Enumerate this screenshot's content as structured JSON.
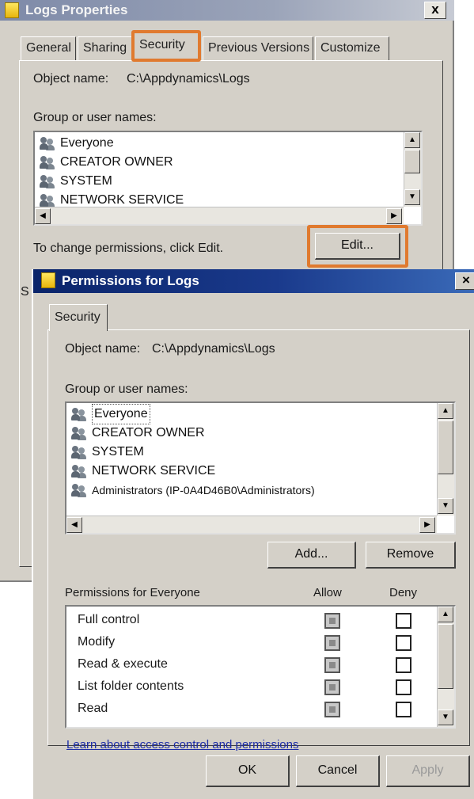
{
  "back_window": {
    "title": "Logs Properties",
    "close_glyph": "x",
    "tabs": [
      "General",
      "Sharing",
      "Security",
      "Previous Versions",
      "Customize"
    ],
    "object_name_label": "Object name:",
    "object_name_value": "C:\\Appdynamics\\Logs",
    "group_label": "Group or user names:",
    "users": [
      "Everyone",
      "CREATOR OWNER",
      "SYSTEM",
      "NETWORK SERVICE"
    ],
    "change_text": "To change permissions, click Edit.",
    "edit_button": "Edit...",
    "side_glyph": "S"
  },
  "front_window": {
    "title": "Permissions for Logs",
    "close_glyph": "×",
    "tab": "Security",
    "object_name_label": "Object name:",
    "object_name_value": "C:\\Appdynamics\\Logs",
    "group_label": "Group or user names:",
    "users": [
      "Everyone",
      "CREATOR OWNER",
      "SYSTEM",
      "NETWORK SERVICE",
      "Administrators (IP-0A4D46B0\\Administrators)"
    ],
    "add_button": "Add...",
    "remove_button": "Remove",
    "permissions_label": "Permissions for Everyone",
    "allow_header": "Allow",
    "deny_header": "Deny",
    "permissions": [
      {
        "name": "Full control",
        "allow": true,
        "deny": false
      },
      {
        "name": "Modify",
        "allow": true,
        "deny": false
      },
      {
        "name": "Read & execute",
        "allow": true,
        "deny": false
      },
      {
        "name": "List folder contents",
        "allow": true,
        "deny": false
      },
      {
        "name": "Read",
        "allow": true,
        "deny": false
      }
    ],
    "learn_link": "Learn about access control and permissions",
    "ok_button": "OK",
    "cancel_button": "Cancel",
    "apply_button": "Apply"
  },
  "colors": {
    "dialog_face": "#d4d0c8",
    "active_title": "#0a246a",
    "inactive_title": "#7e8aa8",
    "highlight_box": "#e07a2f",
    "link": "#1c2ca8"
  },
  "icons": {
    "window": "folder-icon",
    "user": "user-group-icon",
    "scroll_up": "▲",
    "scroll_down": "▼",
    "scroll_left": "◀",
    "scroll_right": "▶"
  }
}
